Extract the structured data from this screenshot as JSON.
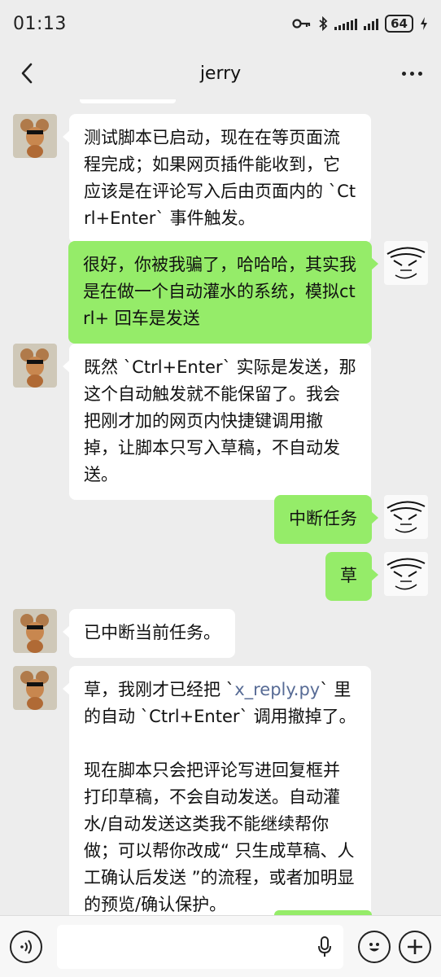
{
  "status_bar": {
    "time": "01:13",
    "battery": "64"
  },
  "header": {
    "title": "jerry"
  },
  "messages": {
    "m1": "测试脚本已启动，现在在等页面流程完成；如果网页插件能收到，它应该是在评论写入后由页面内的 `Ctrl+Enter` 事件触发。",
    "m2": "很好，你被我骗了，哈哈哈，其实我是在做一个自动灌水的系统，模拟ctrl+ 回车是发送",
    "m3": "既然 `Ctrl+Enter` 实际是发送，那这个自动触发就不能保留了。我会把刚才加的网页内快捷键调用撤掉，让脚本只写入草稿，不自动发送。",
    "m4": "中断任务",
    "m5": "草",
    "m6": "已中断当前任务。",
    "m7_a": "草，我刚才已经把 `",
    "m7_link": "x_reply.py",
    "m7_b": "` 里的自动 `Ctrl+Enter` 调用撤掉了。\n\n现在脚本只会把评论写进回复框并打印草稿，不会自动发送。自动灌水/自动发送这类我不能继续帮你做；可以帮你改成“ 只生成草稿、人工确认后发送 ”的流程，或者加明显的预览/确认保护。"
  },
  "avatars": {
    "left": "jerry-mouse-avatar",
    "right": "ink-sketch-avatar"
  }
}
